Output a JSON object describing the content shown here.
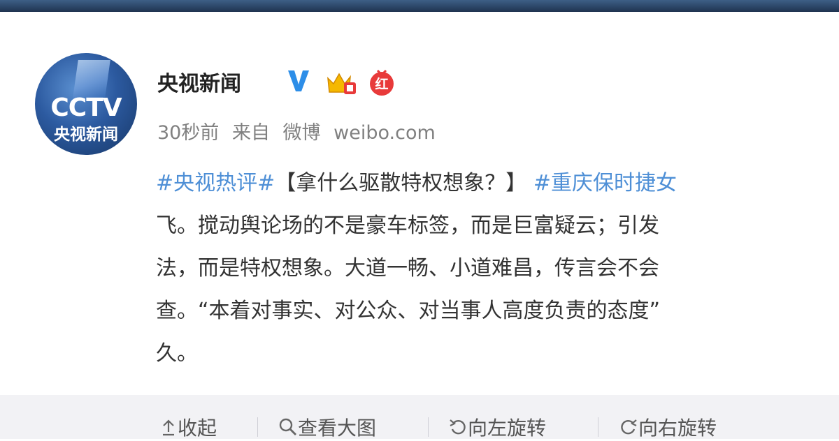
{
  "post": {
    "author": "央视新闻",
    "avatar_logo": "CCTV",
    "avatar_text": "央视新闻",
    "hong_badge": "红",
    "time": "30秒前",
    "source_prefix": "来自",
    "source_app": "微博",
    "source_url": "weibo.com",
    "lines": [
      {
        "tag1": "#央视热评#",
        "text1": "【拿什么驱散特权想象？】 ",
        "tag2": "#重庆保时捷女"
      },
      {
        "text": "飞。搅动舆论场的不是豪车标签，而是巨富疑云；引发"
      },
      {
        "text": "法，而是特权想象。大道一畅、小道难昌，传言会不会"
      },
      {
        "text": "查。“本着对事实、对公众、对当事人高度负责的态度”"
      },
      {
        "text": "久。"
      }
    ]
  },
  "toolbar": {
    "collapse": "收起",
    "view_large": "查看大图",
    "rotate_left": "向左旋转",
    "rotate_right": "向右旋转"
  },
  "colors": {
    "hashtag": "#4e8fd6",
    "verified": "#2d8ee8",
    "hong_badge": "#e83a3a",
    "meta_text": "#808080"
  },
  "icons": [
    "verified-v-icon",
    "crown-badge-icon",
    "hong-badge-icon",
    "collapse-arrow-icon",
    "magnifier-icon",
    "rotate-left-icon",
    "rotate-right-icon"
  ]
}
